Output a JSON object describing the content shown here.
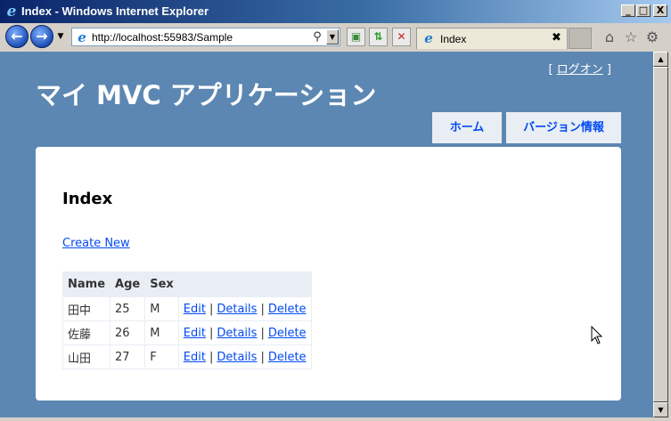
{
  "window": {
    "title": "Index - Windows Internet Explorer",
    "controls": {
      "minimize": "_",
      "maximize": "□",
      "close": "X"
    }
  },
  "toolbar": {
    "address": "http://localhost:55983/Sample",
    "tab_title": "Index",
    "tab_close": "✖",
    "back_glyph": "←",
    "forward_glyph": "→",
    "icons": [
      "compatibility-icon",
      "refresh-icon",
      "stop-icon",
      "home-icon",
      "favorites-icon",
      "tools-icon"
    ]
  },
  "page": {
    "login": {
      "open": "[",
      "link": "ログオン",
      "close": "]"
    },
    "site_title": "マイ MVC アプリケーション",
    "menu": [
      {
        "label": "ホーム"
      },
      {
        "label": "バージョン情報"
      }
    ],
    "heading": "Index",
    "create_link": "Create New",
    "table": {
      "headers": [
        "Name",
        "Age",
        "Sex",
        ""
      ],
      "rows": [
        {
          "name": "田中",
          "age": "25",
          "sex": "M",
          "edit": "Edit",
          "details": "Details",
          "delete": "Delete"
        },
        {
          "name": "佐藤",
          "age": "26",
          "sex": "M",
          "edit": "Edit",
          "details": "Details",
          "delete": "Delete"
        },
        {
          "name": "山田",
          "age": "27",
          "sex": "F",
          "edit": "Edit",
          "details": "Details",
          "delete": "Delete"
        }
      ],
      "separator": "|"
    }
  },
  "colors": {
    "page_background": "#5c87b2",
    "menu_tab_bg": "#e8eef4",
    "link": "#034af3"
  }
}
